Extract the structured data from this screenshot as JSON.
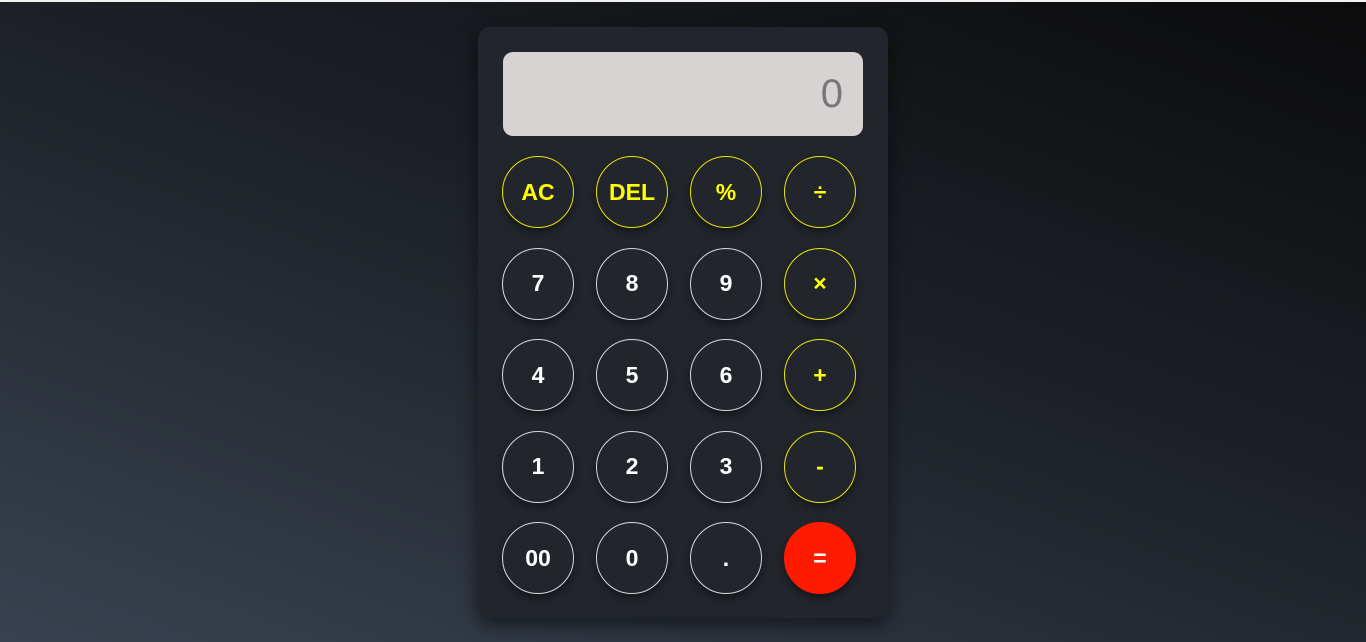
{
  "display": {
    "value": "0"
  },
  "keys": {
    "ac": "AC",
    "del": "DEL",
    "percent": "%",
    "divide": "÷",
    "seven": "7",
    "eight": "8",
    "nine": "9",
    "multiply": "×",
    "four": "4",
    "five": "5",
    "six": "6",
    "add": "+",
    "one": "1",
    "two": "2",
    "three": "3",
    "subtract": "-",
    "double_zero": "00",
    "zero": "0",
    "decimal": ".",
    "equals": "="
  },
  "colors": {
    "operator": "#ffff00",
    "equals_bg": "#ff1a00",
    "display_bg": "#d7d3d2",
    "body_bg": "#22262c"
  }
}
